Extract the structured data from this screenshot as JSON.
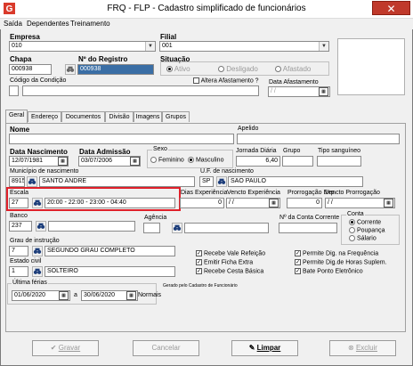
{
  "window": {
    "title": "FRQ - FLP - Cadastro simplificado de funcionários",
    "close": "✕"
  },
  "menu": [
    "Saída",
    "Dependentes",
    "Treinamento"
  ],
  "empresa": {
    "label": "Empresa",
    "value": "010"
  },
  "filial": {
    "label": "Filial",
    "value": "001"
  },
  "chapa": {
    "label": "Chapa",
    "value": "000938"
  },
  "registro": {
    "label": "Nº do Registro",
    "value": "000938"
  },
  "situacao": {
    "label": "Situação",
    "options": [
      "Ativo",
      "Desligado",
      "Afastado"
    ]
  },
  "condicao": {
    "label": "Código da Condição",
    "value": ""
  },
  "afastamento": {
    "check_label": "Altera Afastamento ?",
    "date_label": "Data Afastamento",
    "date": "/ /"
  },
  "tabs": [
    "Geral",
    "Endereço",
    "Documentos",
    "Divisão",
    "Imagens",
    "Grupos"
  ],
  "nome": {
    "label": "Nome",
    "value": ""
  },
  "apelido": {
    "label": "Apelido",
    "value": ""
  },
  "nascimento": {
    "label": "Data Nascimento",
    "value": "12/07/1981"
  },
  "admissao": {
    "label": "Data Admissão",
    "value": "03/07/2006"
  },
  "sexo": {
    "label": "Sexo",
    "options": [
      "Feminino",
      "Masculino"
    ]
  },
  "jornada": {
    "label": "Jornada Diária",
    "value": "6,40"
  },
  "grupo": {
    "label": "Grupo",
    "value": ""
  },
  "sangue": {
    "label": "Tipo sanguíneo",
    "value": ""
  },
  "municipio": {
    "label": "Município de nascimento",
    "code": "8915",
    "name": "SANTO ANDRE"
  },
  "uf": {
    "label": "U.F. de nascimento",
    "code": "SP",
    "name": "SAO PAULO"
  },
  "escala": {
    "label": "Escala",
    "code": "27",
    "desc": "20:00 - 22:00 - 23:00 - 04:40"
  },
  "experiencia": {
    "dias_label": "Dias Experiência",
    "dias": "0",
    "venc_label": "Vencto Experiência",
    "venc": "/ /"
  },
  "prorrogacao": {
    "label": "Prorrogação Exp.",
    "value": "0",
    "venc_label": "Vencto Prorrogação",
    "venc": "/ /"
  },
  "banco": {
    "label": "Banco",
    "value": "237"
  },
  "agencia": {
    "label": "Agência",
    "value": ""
  },
  "conta_corrente": {
    "label": "Nº da Conta Corrente",
    "value": ""
  },
  "conta": {
    "label": "Conta",
    "options": [
      "Corrente",
      "Poupança",
      "Sálario"
    ]
  },
  "instrucao": {
    "label": "Grau de instrução",
    "code": "7",
    "name": "SEGUNDO GRAU COMPLETO"
  },
  "estado_civil": {
    "label": "Estado civil",
    "code": "1",
    "name": "SOLTEIRO"
  },
  "checks_left": [
    "Recebe Vale Refeição",
    "Emitir Ficha Extra",
    "Recebe Cesta Básica"
  ],
  "checks_right": [
    "Permite Dig. na Frequência",
    "Permite Dig.de Horas Suplem.",
    "Bate Ponto Eletrônico"
  ],
  "ferias": {
    "label": "Última férias",
    "from": "01/06/2020",
    "sep": "a",
    "to": "30/06/2020",
    "suffix": "Normais"
  },
  "note": "Gerado pelo Cadastro de Funcionário",
  "buttons": {
    "gravar": "Gravar",
    "cancelar": "Cancelar",
    "limpar": "Limpar",
    "excluir": "Excluir"
  },
  "colors": {
    "highlight": "#e0202a",
    "selection": "#3a6ea5"
  }
}
